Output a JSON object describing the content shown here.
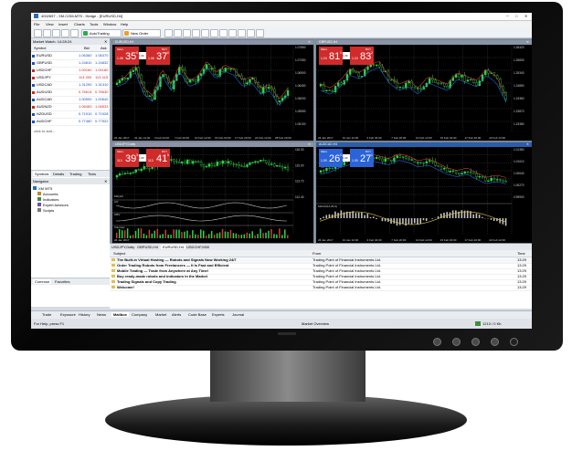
{
  "window": {
    "title": "4002697 - XM.COM-MT5 - Hedge - [EURUSD,H4]",
    "menu": [
      "File",
      "View",
      "Insert",
      "Charts",
      "Tools",
      "Window",
      "Help"
    ],
    "toolbar": {
      "autotrading": "AutoTrading",
      "new_order": "New Order"
    }
  },
  "market_watch": {
    "title": "Market Watch: 14:28:24",
    "headers": [
      "Symbol",
      "Bid",
      "Ask"
    ],
    "rows": [
      {
        "symbol": "EURUSD",
        "bid": "1.06360",
        "ask": "1.06370"
      },
      {
        "symbol": "GBPUSD",
        "bid": "1.24810",
        "ask": "1.24832"
      },
      {
        "symbol": "USDCHF",
        "bid": "1.00160",
        "ask": "1.00180"
      },
      {
        "symbol": "USDJPY",
        "bid": "113.393",
        "ask": "113.415"
      },
      {
        "symbol": "USDCAD",
        "bid": "1.31290",
        "ask": "1.31310"
      },
      {
        "symbol": "AUDUSD",
        "bid": "0.76614",
        "ask": "0.76630"
      },
      {
        "symbol": "AUDCAD",
        "bid": "1.00592",
        "ask": "1.00640"
      },
      {
        "symbol": "AUDNZD",
        "bid": "1.06483",
        "ask": "1.06533"
      },
      {
        "symbol": "NZDUSD",
        "bid": "0.71910",
        "ask": "0.71928"
      },
      {
        "symbol": "AUDCHF",
        "bid": "0.77460",
        "ask": "0.77522"
      }
    ],
    "add_hint": "click to add...",
    "tabs": [
      "Symbols",
      "Details",
      "Trading",
      "Ticks"
    ]
  },
  "navigator": {
    "title": "Navigator",
    "items": [
      "XM MT5",
      "Accounts",
      "Indicators",
      "Expert Advisors",
      "Scripts"
    ],
    "tabs": [
      "Common",
      "Favorites"
    ]
  },
  "charts": [
    {
      "title": "EURUSD,H4",
      "sell_big": "35",
      "sell_small": "1.06",
      "sell_sup": "0",
      "buy_big": "37",
      "buy_small": "1.06",
      "buy_sup": "0",
      "sell_label": "SELL",
      "buy_label": "BUY",
      "lot": "1.00",
      "dates": [
        "26 Jan 2017",
        "31 Jan 12:00",
        "3 Feb 04:00",
        "7 Feb 20:00",
        "10 Feb 12:00",
        "15 Feb 04:00",
        "17 Feb 20:00",
        "22 Feb 12:00",
        "28 Feb 20:00"
      ],
      "axis": [
        "1.07850",
        "1.07350",
        "1.06900",
        "1.06450",
        "1.06000",
        "1.05550",
        "1.05100"
      ]
    },
    {
      "title": "GBPUSD,H4",
      "sell_big": "81",
      "sell_small": "1.24",
      "sell_sup": "0",
      "buy_big": "83",
      "buy_small": "1.24",
      "buy_sup": "2",
      "sell_label": "SELL",
      "buy_label": "BUY",
      "lot": "1.00",
      "dates": [
        "26 Jan 2017",
        "31 Jan 12:00",
        "3 Feb 04:00",
        "7 Feb 20:00",
        "10 Feb 12:00",
        "15 Feb 04:00",
        "17 Feb 20:00",
        "22 Feb 12:00"
      ],
      "axis": [
        "1.26320",
        "1.25830",
        "1.25340",
        "1.24850",
        "1.24360",
        "1.23870",
        "1.23380"
      ]
    },
    {
      "title": "USDJPY,Daily",
      "sell_big": "39",
      "sell_small": "113",
      "sell_sup": "3",
      "buy_big": "41",
      "buy_small": "113",
      "buy_sup": "5",
      "sell_label": "SELL",
      "buy_label": "BUY",
      "lot": "1.00",
      "sub1": "MA(12)",
      "sub2": "AO",
      "sub3": "OBV",
      "sub4": "Volumes",
      "dates": [
        "26 Jan 2017"
      ],
      "axis": [
        "116.30",
        "115.00",
        "113.70",
        "112.40"
      ]
    },
    {
      "title": "AUDCAD,H4",
      "sell_big": "26",
      "sell_small": "1.00",
      "sell_sup": "0",
      "buy_big": "27",
      "buy_small": "1.00",
      "buy_sup": "1",
      "sell_label": "SELL",
      "buy_label": "BUY",
      "lot": "1.00",
      "sub1": "MACD(12,26,9)",
      "dates": [
        "26 Jan 2017",
        "31 Jan 12:00",
        "3 Feb 04:00",
        "7 Feb 20:00",
        "10 Feb 12:00",
        "15 Feb 04:00",
        "17 Feb 20:00",
        "22 Feb 12:00"
      ],
      "axis": [
        "1.01380",
        "1.01010",
        "1.00640",
        "1.00270",
        "0.99900"
      ]
    }
  ],
  "chart_tabs": [
    "USDJPY,Daily",
    "GBPUSD,H4",
    "EURUSD,H4",
    "USDCHF,M30"
  ],
  "mailbox": {
    "headers": [
      "Subject",
      "From",
      "Time"
    ],
    "rows": [
      {
        "subject": "The Built-in Virtual Hosting — Robots and Signals Now Working 24/7",
        "from": "Trading Point of Financial Instruments Ltd.",
        "time": "13:29"
      },
      {
        "subject": "Order Trading Robots from Freelancers — It Is Fast and Efficient",
        "from": "Trading Point of Financial Instruments Ltd.",
        "time": "13:29"
      },
      {
        "subject": "Mobile Trading — Trade from Anywhere at Any Time!",
        "from": "Trading Point of Financial Instruments Ltd.",
        "time": "13:29"
      },
      {
        "subject": "Buy ready-made robots and indicators in the Market",
        "from": "Trading Point of Financial Instruments Ltd.",
        "time": "13:29"
      },
      {
        "subject": "Trading Signals and Copy Trading",
        "from": "Trading Point of Financial Instruments Ltd.",
        "time": "13:29"
      },
      {
        "subject": "Welcome!",
        "from": "Trading Point of Financial Instruments Ltd.",
        "time": "13:29"
      }
    ]
  },
  "bottom_tabs": [
    "Trade",
    "Exposure",
    "History",
    "News",
    "Mailbox",
    "Company",
    "Market",
    "Alerts",
    "Code Base",
    "Experts",
    "Journal"
  ],
  "status": {
    "left": "For Help, press F1",
    "center": "Market Overview",
    "right": "1213 / 0 Kb"
  }
}
